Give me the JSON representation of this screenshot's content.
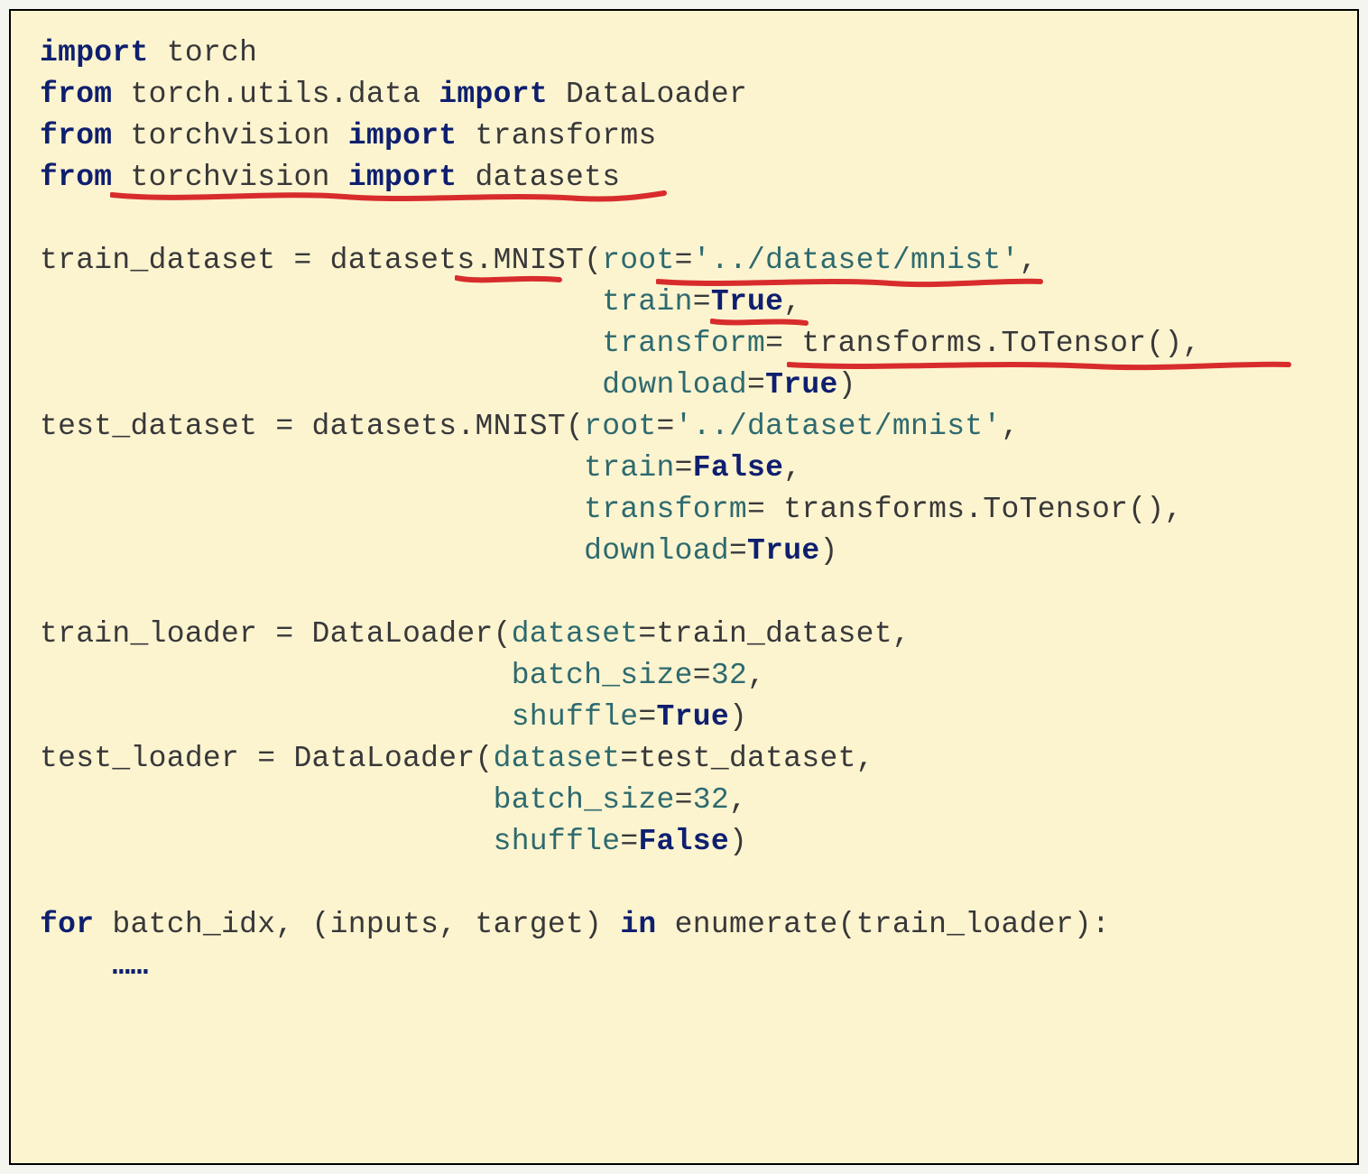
{
  "code": {
    "line1": {
      "kw1": "import",
      "sp1": " ",
      "id1": "torch"
    },
    "line2": {
      "kw1": "from",
      "sp1": " ",
      "id1": "torch.utils.data",
      "sp2": " ",
      "kw2": "import",
      "sp3": " ",
      "id2": "DataLoader"
    },
    "line3": {
      "kw1": "from",
      "sp1": " ",
      "id1": "torchvision",
      "sp2": " ",
      "kw2": "import",
      "sp3": " ",
      "id2": "transforms"
    },
    "line4": {
      "kw1": "from",
      "sp1": " ",
      "id1": "torchvision",
      "sp2": " ",
      "kw2": "import",
      "sp3": " ",
      "id2": "datasets"
    },
    "line6a": {
      "id1": "train_dataset = datasets.MNIST(",
      "p1": "root",
      "eq1": "=",
      "s1": "'../dataset/mnist'",
      "c1": ","
    },
    "line6b": {
      "pad": "                               ",
      "p1": "train",
      "eq1": "=",
      "b1": "True",
      "c1": ","
    },
    "line6c": {
      "pad": "                               ",
      "p1": "transform",
      "eq1": "= ",
      "v1": "transforms.ToTensor()",
      "c1": ","
    },
    "line6d": {
      "pad": "                               ",
      "p1": "download",
      "eq1": "=",
      "b1": "True",
      "c1": ")"
    },
    "line7a": {
      "id1": "test_dataset = datasets.MNIST(",
      "p1": "root",
      "eq1": "=",
      "s1": "'../dataset/mnist'",
      "c1": ","
    },
    "line7b": {
      "pad": "                              ",
      "p1": "train",
      "eq1": "=",
      "b1": "False",
      "c1": ","
    },
    "line7c": {
      "pad": "                              ",
      "p1": "transform",
      "eq1": "= ",
      "v1": "transforms.ToTensor()",
      "c1": ","
    },
    "line7d": {
      "pad": "                              ",
      "p1": "download",
      "eq1": "=",
      "b1": "True",
      "c1": ")"
    },
    "line9a": {
      "id1": "train_loader = DataLoader(",
      "p1": "dataset",
      "eq1": "=",
      "v1": "train_dataset,"
    },
    "line9b": {
      "pad": "                          ",
      "p1": "batch_size",
      "eq1": "=",
      "n1": "32",
      "c1": ","
    },
    "line9c": {
      "pad": "                          ",
      "p1": "shuffle",
      "eq1": "=",
      "b1": "True",
      "c1": ")"
    },
    "line10a": {
      "id1": "test_loader = DataLoader(",
      "p1": "dataset",
      "eq1": "=",
      "v1": "test_dataset,"
    },
    "line10b": {
      "pad": "                         ",
      "p1": "batch_size",
      "eq1": "=",
      "n1": "32",
      "c1": ","
    },
    "line10c": {
      "pad": "                         ",
      "p1": "shuffle",
      "eq1": "=",
      "b1": "False",
      "c1": ")"
    },
    "line12": {
      "kw1": "for",
      "sp1": " ",
      "id1": "batch_idx, (inputs, target)",
      "sp2": " ",
      "kw2": "in",
      "sp3": " ",
      "id2": "enumerate(train_loader):"
    },
    "line13": {
      "pad": "    ",
      "dots": "……"
    }
  },
  "annotations": {
    "underline1_target": "torchvision import datasets (line 4)",
    "underline2_target": "MNIST (train_dataset line)",
    "underline3_target": "'../dataset/mnist' (train_dataset root)",
    "underline4_target": "True (train_dataset train=True)",
    "underline5_target": "transforms.ToTensor() (train_dataset transform)"
  }
}
